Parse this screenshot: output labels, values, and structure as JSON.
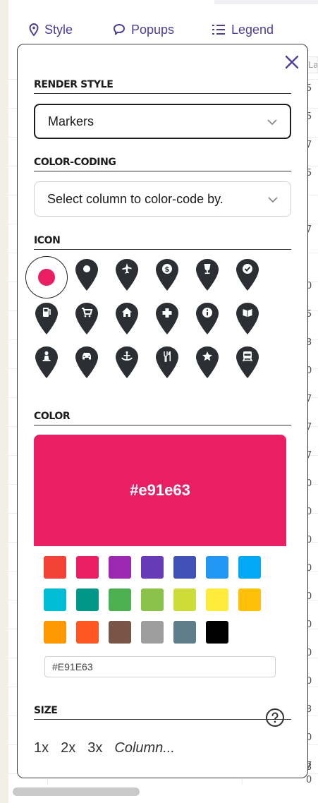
{
  "tabs": [
    {
      "label": "Style",
      "icon": "map-pin-icon"
    },
    {
      "label": "Popups",
      "icon": "speech-bubble-icon"
    },
    {
      "label": "Legend",
      "icon": "list-icon"
    }
  ],
  "background": {
    "header_cell": "La",
    "right_fragments": [
      "5",
      "5",
      "7",
      "5",
      "7",
      "l",
      "0",
      "5",
      "3",
      "0",
      "7",
      "7",
      "7",
      "0",
      "0",
      "0",
      "0",
      "0",
      "0",
      "0",
      "0",
      "3",
      "0",
      "7",
      "0",
      "3"
    ]
  },
  "panel": {
    "render_style": {
      "title": "RENDER STYLE",
      "value": "Markers"
    },
    "color_coding": {
      "title": "COLOR-CODING",
      "placeholder": "Select column to color-code by."
    },
    "icon": {
      "title": "ICON",
      "selected": "dot",
      "items": [
        "dot-icon",
        "pin-plain-icon",
        "airplane-icon",
        "dollar-icon",
        "wine-glass-icon",
        "checkmark-icon",
        "gas-pump-icon",
        "shopping-cart-icon",
        "home-icon",
        "plus-icon",
        "info-icon",
        "book-icon",
        "person-icon",
        "car-icon",
        "ship-icon",
        "restaurant-icon",
        "star-icon",
        "train-icon"
      ]
    },
    "color": {
      "title": "COLOR",
      "selected_hex_display": "#e91e63",
      "input_value": "#E91E63",
      "swatches": [
        "#f44336",
        "#e91e63",
        "#9c27b0",
        "#673ab7",
        "#3f51b5",
        "#2196f3",
        "#03a9f4",
        "#00bcd4",
        "#009688",
        "#4caf50",
        "#8bc34a",
        "#cddc39",
        "#ffeb3b",
        "#ffc107",
        "#ff9800",
        "#ff5722",
        "#795548",
        "#9e9e9e",
        "#607d8b",
        "#000000"
      ]
    },
    "size": {
      "title": "SIZE",
      "options": [
        "1x",
        "2x",
        "3x",
        "Column..."
      ]
    }
  },
  "colors": {
    "accent": "#4b3f99",
    "selected": "#e91e63",
    "pin": "#2b2f33"
  }
}
